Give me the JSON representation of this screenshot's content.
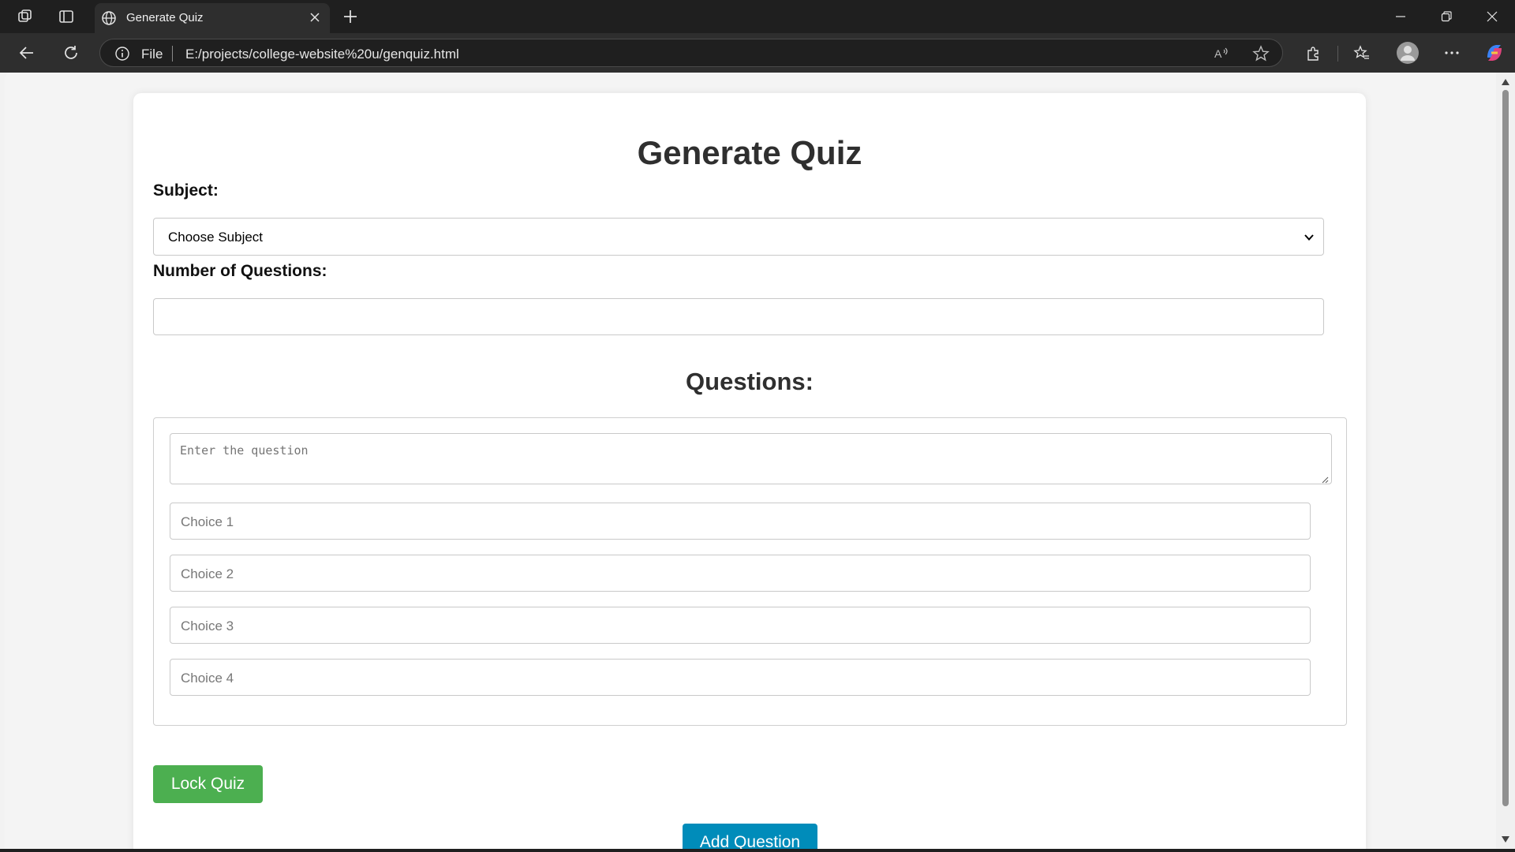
{
  "browser": {
    "tab_title": "Generate Quiz",
    "address_scheme": "File",
    "url": "E:/projects/college-website%20u/genquiz.html"
  },
  "page": {
    "title": "Generate Quiz",
    "subject_label": "Subject:",
    "subject_selected": "Choose Subject",
    "num_questions_label": "Number of Questions:",
    "num_questions_value": "",
    "questions_heading": "Questions:",
    "question_placeholder": "Enter the question",
    "choices": [
      {
        "placeholder": "Choice 1"
      },
      {
        "placeholder": "Choice 2"
      },
      {
        "placeholder": "Choice 3"
      },
      {
        "placeholder": "Choice 4"
      }
    ],
    "lock_button": "Lock Quiz",
    "add_button": "Add Question"
  },
  "colors": {
    "lock_button": "#4caf50",
    "add_button": "#008cba"
  },
  "icons": [
    "workspaces-icon",
    "tab-actions-icon",
    "globe-icon",
    "close-icon",
    "plus-icon",
    "minimize-icon",
    "restore-icon",
    "close-window-icon",
    "back-icon",
    "refresh-icon",
    "info-icon",
    "read-aloud-icon",
    "star-icon",
    "extensions-icon",
    "favorites-icon",
    "profile-icon",
    "more-icon",
    "copilot-icon",
    "chevron-down-icon"
  ]
}
